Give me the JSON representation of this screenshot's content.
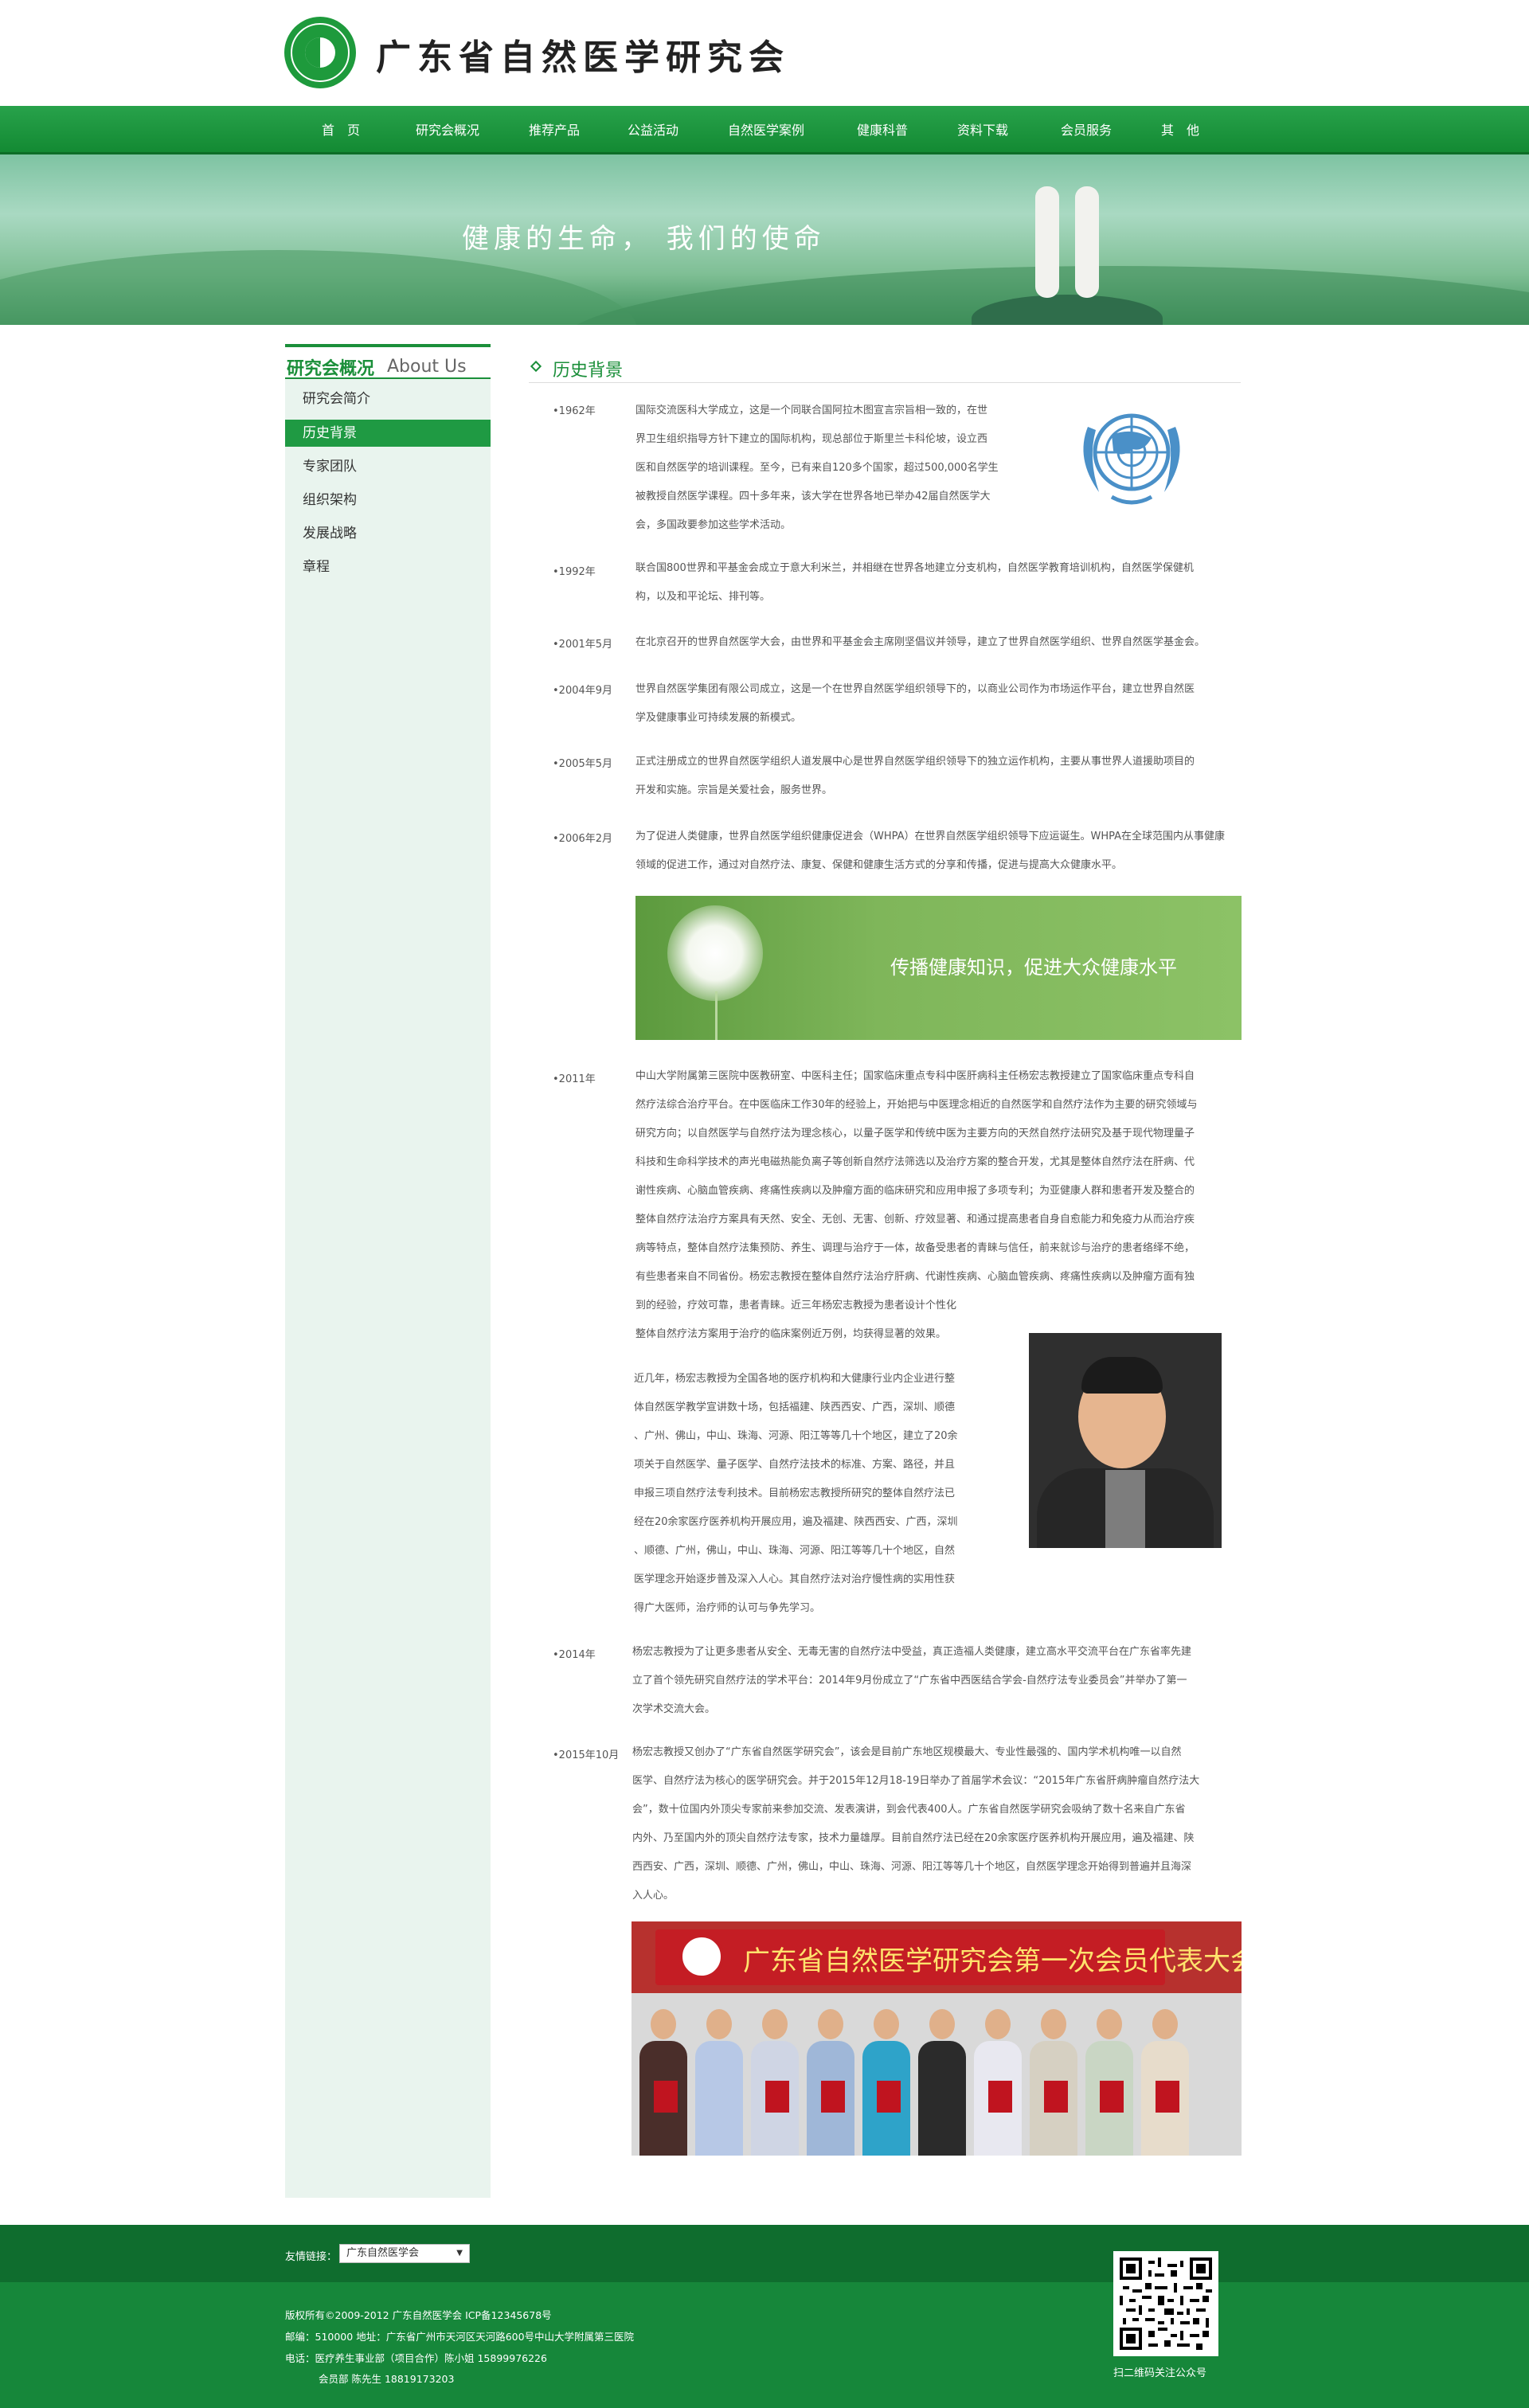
{
  "header": {
    "site_title": "广东省自然医学研究会"
  },
  "nav": {
    "items": [
      "首　页",
      "研究会概况",
      "推荐产品",
      "公益活动",
      "自然医学案例",
      "健康科普",
      "资料下载",
      "会员服务",
      "其　他"
    ]
  },
  "banner": {
    "slogan": "健康的生命，  我们的使命"
  },
  "sidebar": {
    "title_cn": "研究会概况",
    "title_en": "About Us",
    "items": [
      {
        "label": "研究会简介",
        "active": false
      },
      {
        "label": "历史背景",
        "active": true
      },
      {
        "label": "专家团队",
        "active": false
      },
      {
        "label": "组织架构",
        "active": false
      },
      {
        "label": "发展战略",
        "active": false
      },
      {
        "label": "章程",
        "active": false
      }
    ]
  },
  "content": {
    "section_title": "历史背景",
    "dandelion_caption": "传播健康知识，促进大众健康水平",
    "group_photo_banner": "广东省自然医学研究会第一次会员代表大会",
    "timeline": [
      {
        "date": "•1962年",
        "lines": [
          "国际交流医科大学成立，这是一个同联合国阿拉木图宣言宗旨相一致的，在世",
          "界卫生组织指导方针下建立的国际机构，现总部位于斯里兰卡科伦坡，设立西",
          "医和自然医学的培训课程。至今，已有来自120多个国家，超过500,000名学生",
          "被教授自然医学课程。四十多年来，该大学在世界各地已举办42届自然医学大",
          "会，多国政要参加这些学术活动。"
        ]
      },
      {
        "date": "•1992年",
        "lines": [
          "联合国800世界和平基金会成立于意大利米兰，并相继在世界各地建立分支机构，自然医学教育培训机构，自然医学保健机",
          "构，以及和平论坛、排刊等。"
        ]
      },
      {
        "date": "•2001年5月",
        "lines": [
          "在北京召开的世界自然医学大会，由世界和平基金会主席刚坚倡议并领导，建立了世界自然医学组织、世界自然医学基金会。"
        ]
      },
      {
        "date": "•2004年9月",
        "lines": [
          "世界自然医学集团有限公司成立，这是一个在世界自然医学组织领导下的，以商业公司作为市场运作平台，建立世界自然医",
          "学及健康事业可持续发展的新模式。"
        ]
      },
      {
        "date": "•2005年5月",
        "lines": [
          "正式注册成立的世界自然医学组织人道发展中心是世界自然医学组织领导下的独立运作机构，主要从事世界人道援助项目的",
          "开发和实施。宗旨是关爱社会，服务世界。"
        ]
      },
      {
        "date": "•2006年2月",
        "lines": [
          "为了促进人类健康，世界自然医学组织健康促进会（WHPA）在世界自然医学组织领导下应运诞生。WHPA在全球范围内从事健康",
          "领域的促进工作，通过对自然疗法、康复、保健和健康生活方式的分享和传播，促进与提高大众健康水平。"
        ]
      },
      {
        "date": "•2011年",
        "lines": [
          "中山大学附属第三医院中医教研室、中医科主任；国家临床重点专科中医肝病科主任杨宏志教授建立了国家临床重点专科自",
          "然疗法综合治疗平台。在中医临床工作30年的经验上，开始把与中医理念相近的自然医学和自然疗法作为主要的研究领域与",
          "研究方向；以自然医学与自然疗法为理念核心，以量子医学和传统中医为主要方向的天然自然疗法研究及基于现代物理量子",
          "科技和生命科学技术的声光电磁热能负离子等创新自然疗法筛选以及治疗方案的整合开发，尤其是整体自然疗法在肝病、代",
          "谢性疾病、心脑血管疾病、疼痛性疾病以及肿瘤方面的临床研究和应用申报了多项专利；为亚健康人群和患者开发及整合的",
          "整体自然疗法治疗方案具有天然、安全、无创、无害、创新、疗效显著、和通过提高患者自身自愈能力和免疫力从而治疗疾",
          "病等特点，整体自然疗法集预防、养生、调理与治疗于一体，故备受患者的青睐与信任，前来就诊与治疗的患者络绎不绝，",
          "有些患者来自不同省份。杨宏志教授在整体自然疗法治疗肝病、代谢性疾病、心脑血管疾病、疼痛性疾病以及肿瘤方面有独",
          "到的经验，疗效可靠，患者青睐。近三年杨宏志教授为患者设计个性化",
          "整体自然疗法方案用于治疗的临床案例近万例，均获得显著的效果。"
        ],
        "extra_lines": [
          "近几年，杨宏志教授为全国各地的医疗机构和大健康行业内企业进行整",
          "体自然医学教学宣讲数十场，包括福建、陕西西安、广西，深圳、顺德",
          "、广州、佛山，中山、珠海、河源、阳江等等几十个地区，建立了20余",
          "项关于自然医学、量子医学、自然疗法技术的标准、方案、路径，并且",
          "申报三项自然疗法专利技术。目前杨宏志教授所研究的整体自然疗法已",
          "经在20余家医疗医养机构开展应用，遍及福建、陕西西安、广西，深圳",
          "、顺德、广州，佛山，中山、珠海、河源、阳江等等几十个地区，自然",
          "医学理念开始逐步普及深入人心。其自然疗法对治疗慢性病的实用性获",
          "得广大医师，治疗师的认可与争先学习。"
        ]
      },
      {
        "date": "•2014年",
        "lines": [
          "杨宏志教授为了让更多患者从安全、无毒无害的自然疗法中受益，真正造福人类健康，建立高水平交流平台在广东省率先建",
          "立了首个领先研究自然疗法的学术平台：2014年9月份成立了“广东省中西医结合学会-自然疗法专业委员会”并举办了第一",
          "次学术交流大会。"
        ]
      },
      {
        "date": "•2015年10月",
        "lines": [
          "杨宏志教授又创办了“广东省自然医学研究会”，该会是目前广东地区规模最大、专业性最强的、国内学术机构唯一以自然",
          "医学、自然疗法为核心的医学研究会。并于2015年12月18-19日举办了首届学术会议：“2015年广东省肝病肿瘤自然疗法大",
          "会”，数十位国内外顶尖专家前来参加交流、发表演讲，到会代表400人。广东省自然医学研究会吸纳了数十名来自广东省",
          "内外、乃至国内外的顶尖自然疗法专家，技术力量雄厚。目前自然疗法已经在20余家医疗医养机构开展应用，遍及福建、陕",
          "西西安、广西，深圳、顺德、广州，佛山，中山、珠海、河源、阳江等等几十个地区，自然医学理念开始得到普遍并且海深",
          "入人心。"
        ]
      }
    ]
  },
  "footer": {
    "links_label": "友情链接：",
    "links_select_value": "广东自然医学会",
    "copyright": "版权所有©2009-2012 广东自然医学会  ICP备12345678号",
    "address": "邮编：510000    地址：广东省广州市天河区天河路600号中山大学附属第三医院",
    "phone": "电话：医疗养生事业部（项目合作）陈小姐 15899976226",
    "member": "会员部 陈先生 18819173203",
    "qr_caption": "扫二维码关注公众号"
  }
}
